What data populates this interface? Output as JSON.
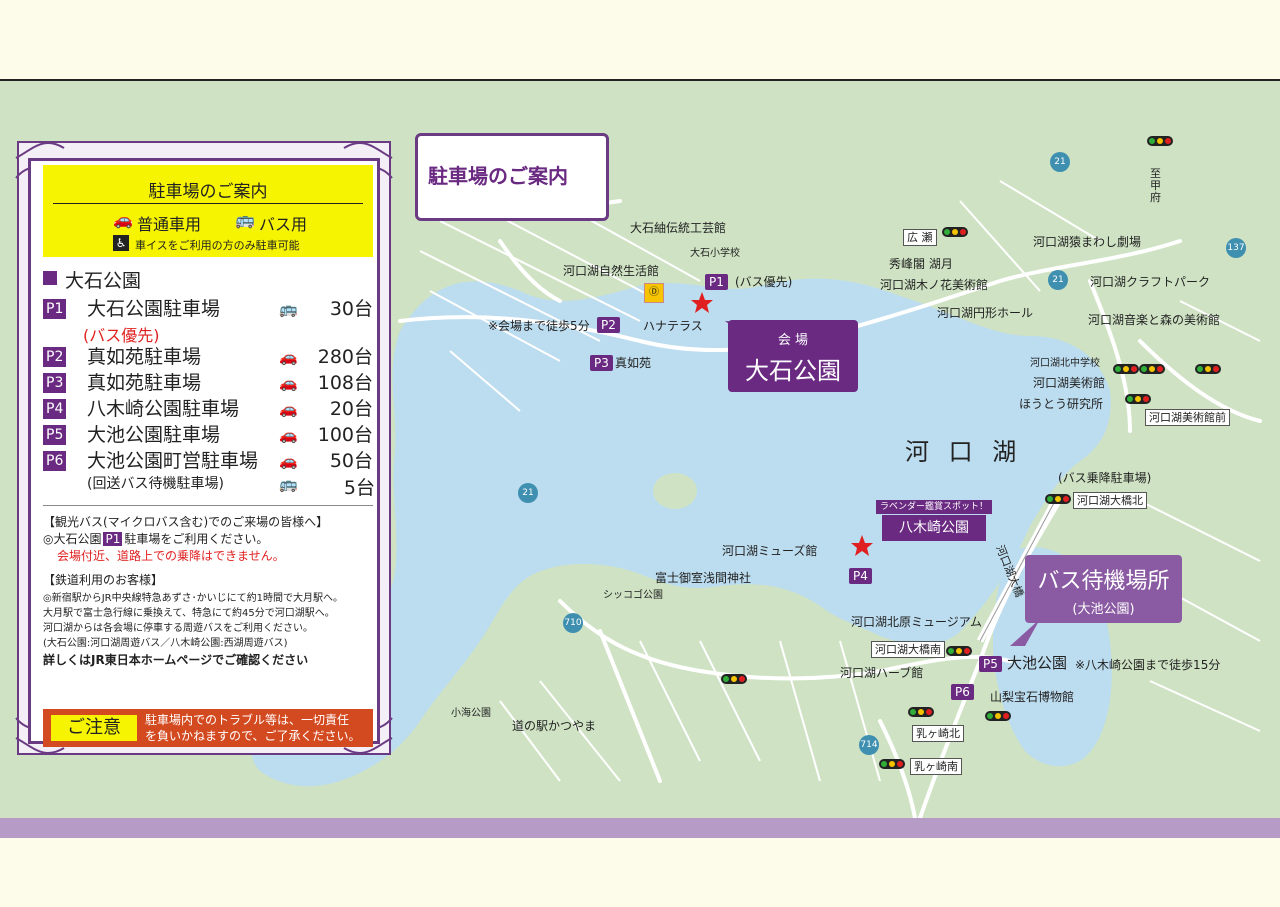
{
  "map": {
    "lake_name": "河 口 湖",
    "header_box": "駐車場のご案内",
    "venue_main": {
      "small": "会 場",
      "name": "大石公園"
    },
    "bus_wait": {
      "title": "バス待機場所",
      "sub": "(大池公園)"
    },
    "lavender_spot": {
      "ribbon": "ラベンダー鑑賞スポット！",
      "name": "八木崎公園"
    },
    "labels": {
      "oishi_tsumugi": "大石紬伝統工芸館",
      "oishi_school": "大石小学校",
      "nature_center": "河口湖自然生活館",
      "p1_bus": "(バス優先)",
      "walk_5": "※会場まで徒歩5分",
      "hanaterrace": "ハナテラス",
      "shinnyoen": "真如苑",
      "hirose": "広 瀬",
      "shuhokaku": "秀峰閣 湖月",
      "konohana": "河口湖木ノ花美術館",
      "enkei_hall": "河口湖円形ホール",
      "saru": "河口湖猿まわし劇場",
      "craft_park": "河口湖クラフトパーク",
      "music_forest": "河口湖音楽と森の美術館",
      "north_jhs": "河口湖北中学校",
      "art_museum": "河口湖美術館",
      "houtou": "ほうとう研究所",
      "art_museum_mae": "河口湖美術館前",
      "bus_parking": "(バス乗降駐車場)",
      "ohashi_kita": "河口湖大橋北",
      "ohashi_road": "河口湖大橋",
      "kaiyu": "至甲府",
      "muse": "河口湖ミューズ館",
      "asama": "富士御室浅間神社",
      "shikkogo": "シッコゴ公園",
      "kitahara": "河口湖北原ミュージアム",
      "ohashi_minami": "河口湖大橋南",
      "oike": "大池公園",
      "walk_15": "※八木崎公園まで徒歩15分",
      "herb": "河口湖ハーブ館",
      "houseki": "山梨宝石博物館",
      "ubagasaki_kita": "乳ヶ崎北",
      "ubagasaki_minami": "乳ヶ崎南",
      "kouminkouen": "小海公園",
      "michinoeki": "道の駅かつやま"
    },
    "roads": [
      "21",
      "21",
      "21",
      "137",
      "710",
      "714"
    ],
    "p_badges": {
      "p1": "P1",
      "p2": "P2",
      "p3": "P3",
      "p4": "P4",
      "p5": "P5",
      "p6": "P6"
    }
  },
  "panel": {
    "title": "駐車場のご案内",
    "car_label": "普通車用",
    "bus_label": "バス用",
    "wheel_note": "車イスをご利用の方のみ駐車可能",
    "park_name": "大石公園",
    "rows": [
      {
        "badge": "P1",
        "name": "大石公園駐車場",
        "sub": "(バス優先)",
        "icon": "🚌",
        "count": "30台"
      },
      {
        "badge": "P2",
        "name": "真如苑駐車場",
        "icon": "🚗",
        "count": "280台"
      },
      {
        "badge": "P3",
        "name": "真如苑駐車場",
        "icon": "🚗",
        "count": "108台"
      },
      {
        "badge": "P4",
        "name": "八木崎公園駐車場",
        "icon": "🚗",
        "count": "20台"
      },
      {
        "badge": "P5",
        "name": "大池公園駐車場",
        "icon": "🚗",
        "count": "100台"
      },
      {
        "badge": "P6",
        "name": "大池公園町営駐車場",
        "sub": "(回送バス待機駐車場)",
        "icon": "🚗",
        "count": "50台",
        "icon2": "🚌",
        "count2": "5台"
      }
    ],
    "tour_head": "【観光バス(マイクロバス含む)でのご来場の皆様へ】",
    "tour_line1a": "◎大石公園",
    "tour_line1b": "P1",
    "tour_line1c": "駐車場をご利用ください。",
    "tour_line2": "会場付近、道路上での乗降はできません。",
    "rail_head": "【鉄道利用のお客様】",
    "rail_1": "◎新宿駅からJR中央線特急あずさ･かいじにて約1時間で大月駅へ。",
    "rail_2": "大月駅で富士急行線に乗換えて、特急にて約45分で河口湖駅へ。",
    "rail_3": "河口湖からは各会場に停車する周遊バスをご利用ください。",
    "rail_4": "(大石公園:河口湖周遊バス／八木崎公園:西湖周遊バス)",
    "rail_5": "詳しくはJR東日本ホームページでご確認ください",
    "caution_label": "ご注意",
    "caution_1": "駐車場内でのトラブル等は、一切責任",
    "caution_2": "を負いかねますので、ご了承ください。"
  },
  "colors": {
    "accent_purple": "#6a2a82",
    "lake_blue": "#bcdcef",
    "land_green": "#cfe3c4",
    "legend_yellow": "#f6f400",
    "caution_orange": "#d44a20",
    "band_lavender": "#b79bc7"
  }
}
